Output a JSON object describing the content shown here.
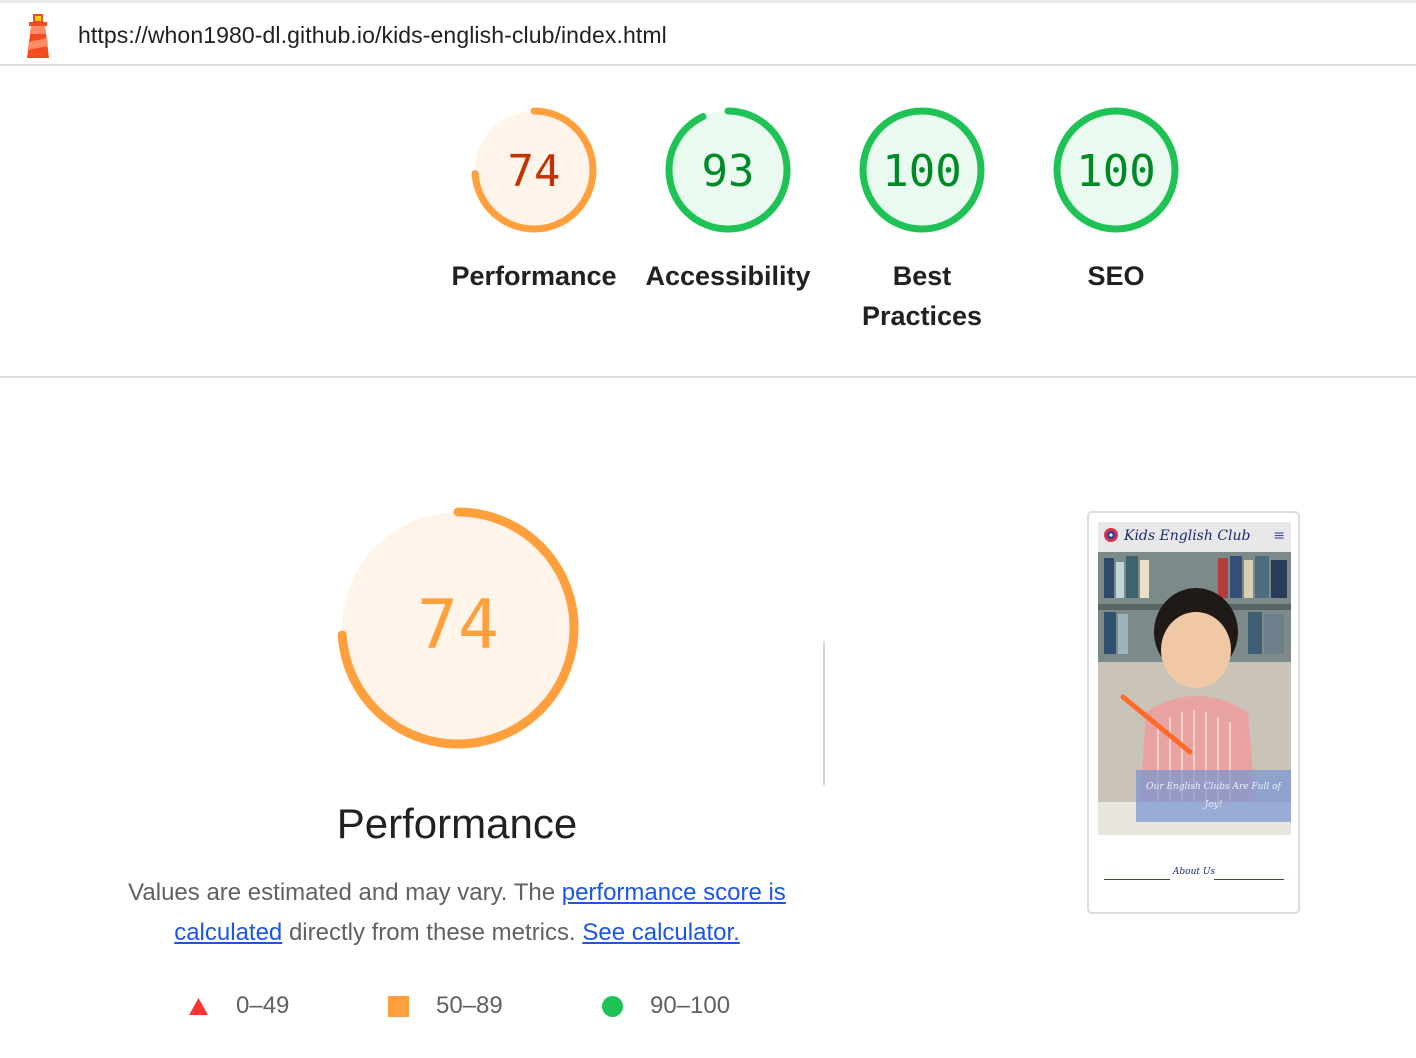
{
  "url": "https://whon1980-dl.github.io/kids-english-club/index.html",
  "colors": {
    "average": "#ffa03c",
    "average_text": "#c33300",
    "average_bg": "#fff4ea",
    "pass": "#1fc355",
    "pass_text": "#008a26",
    "pass_bg": "#eafaf0",
    "fail": "#f33",
    "link": "#1a56e8"
  },
  "gauges": [
    {
      "score": "74",
      "value": 0.74,
      "label": "Performance",
      "rating": "average"
    },
    {
      "score": "93",
      "value": 0.93,
      "label": "Accessibility",
      "rating": "pass"
    },
    {
      "score": "100",
      "value": 1.0,
      "label": "Best Practices",
      "rating": "pass"
    },
    {
      "score": "100",
      "value": 1.0,
      "label": "SEO",
      "rating": "pass"
    }
  ],
  "performance": {
    "score": "74",
    "value": 0.74,
    "title": "Performance",
    "desc_prefix": "Values are estimated and may vary. The ",
    "link_score": "performance score is calculated",
    "desc_middle": " directly from these metrics. ",
    "link_calc": "See calculator."
  },
  "legend": [
    {
      "range": "0–49",
      "icon": "red-triangle-icon"
    },
    {
      "range": "50–89",
      "icon": "orange-square-icon"
    },
    {
      "range": "90–100",
      "icon": "green-circle-icon"
    }
  ],
  "screenshot": {
    "site_title": "Kids English Club",
    "caption": "Our English Clubs Are Full of Joy!",
    "about": "About Us"
  }
}
